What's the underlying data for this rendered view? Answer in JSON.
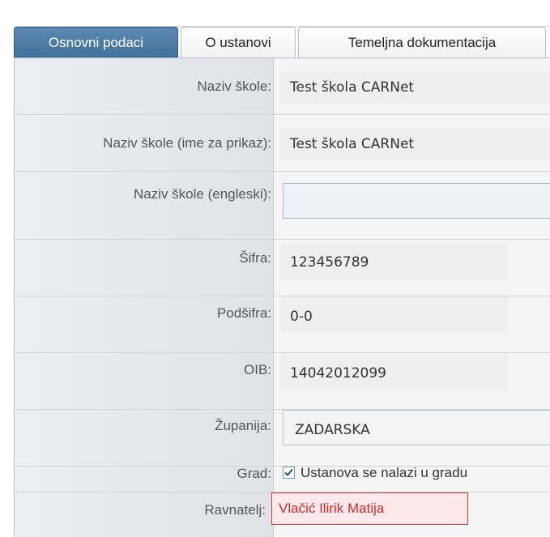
{
  "tabs": [
    {
      "label": "Osnovni podaci",
      "active": true
    },
    {
      "label": "O ustanovi",
      "active": false
    },
    {
      "label": "Temeljna dokumentacija",
      "active": false
    }
  ],
  "form": {
    "naziv_skole": {
      "label": "Naziv škole:",
      "value": "Test škola CARNet"
    },
    "naziv_prikaz": {
      "label": "Naziv škole (ime za prikaz):",
      "value": "Test škola CARNet"
    },
    "naziv_engleski": {
      "label": "Naziv škole (engleski):",
      "value": ""
    },
    "sifra": {
      "label": "Šifra:",
      "value": "123456789"
    },
    "podsifra": {
      "label": "Podšifra:",
      "value": "0-0"
    },
    "oib": {
      "label": "OIB:",
      "value": "14042012099"
    },
    "zupanija": {
      "label": "Županija:",
      "value": "ZADARSKA"
    },
    "grad": {
      "label": "Grad:",
      "checkbox_label": "Ustanova se nalazi u gradu",
      "checked": true
    },
    "ravnatelj": {
      "label": "Ravnatelj:",
      "value": "Vlačić Ilirik Matija"
    }
  },
  "colors": {
    "active_tab": "#4a7aa5",
    "error_border": "#cc4040",
    "error_text": "#cc2a2a"
  }
}
